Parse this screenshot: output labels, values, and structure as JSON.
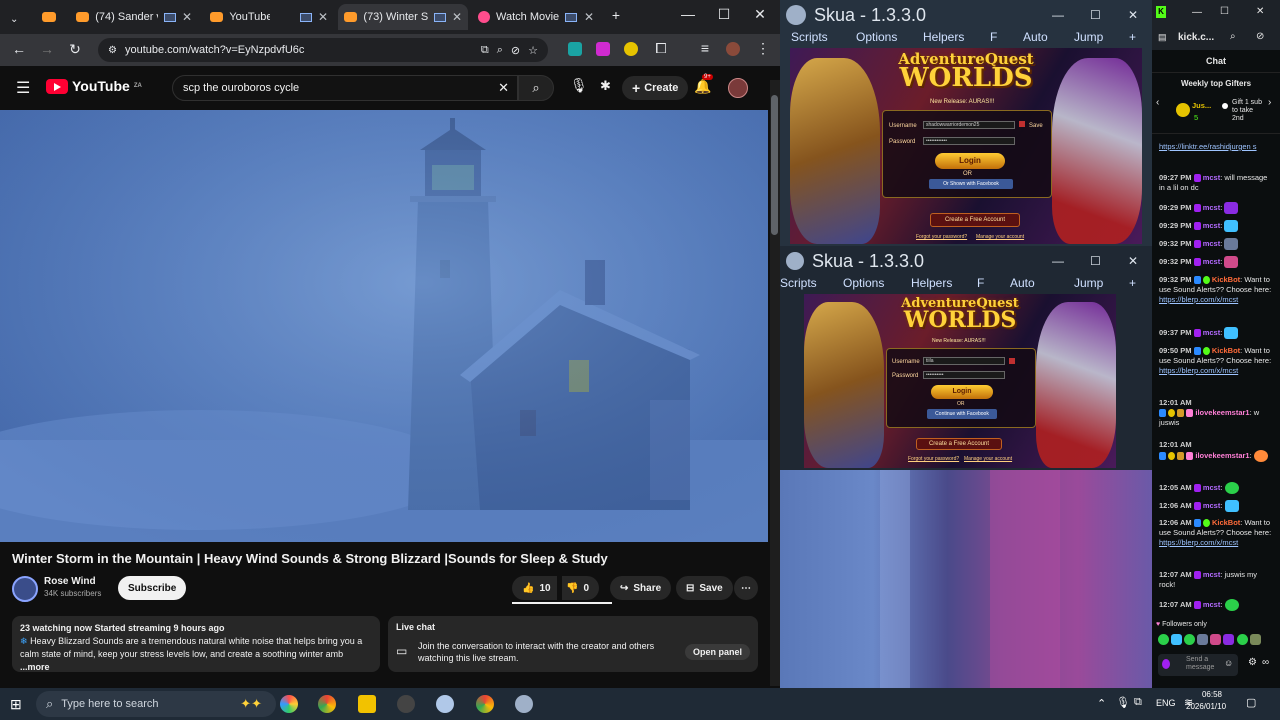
{
  "chrome": {
    "tabs": [
      {
        "label": "(74) Sander v"
      },
      {
        "label": "YouTube"
      },
      {
        "label": "(73) Winter St"
      },
      {
        "label": "Watch Movie"
      }
    ],
    "new_tab": "+",
    "url": "youtube.com/watch?v=EyNzpdvfU6c"
  },
  "youtube": {
    "logo": "YouTube",
    "region": "ZA",
    "search_value": "scp the ouroboros cycle",
    "create_label": "Create",
    "notif_count": "9+",
    "video_title": "Winter Storm in the Mountain | Heavy Wind Sounds & Strong Blizzard |Sounds for Sleep & Study",
    "channel_name": "Rose Wind",
    "subscribers": "34K subscribers",
    "subscribe_label": "Subscribe",
    "likes": "10",
    "dislikes": "0",
    "share_label": "Share",
    "save_label": "Save",
    "desc_stats": "23 watching now  Started streaming 9 hours ago",
    "desc_text": "Heavy Blizzard Sounds are a tremendous natural white noise that helps bring you a calm state of mind, keep your stress levels low, and create a soothing winter amb",
    "desc_more": "...more",
    "live_chat_title": "Live chat",
    "live_chat_text": "Join the conversation to interact with the creator and others watching this live stream.",
    "open_panel": "Open panel"
  },
  "skua_top": {
    "title": "Skua - 1.3.3.0",
    "menu": [
      "Scripts",
      "Options",
      "Helpers",
      "F",
      "Auto",
      "Jump",
      "+"
    ],
    "logo_line1": "AdventureQuest",
    "logo_line2": "WORLDS",
    "release": "New Release: AURAS!!!",
    "username_label": "Username",
    "username_value": "shadowwarriordemon25",
    "password_label": "Password",
    "password_value": "••••••••••••",
    "save_label": "Save",
    "login": "Login",
    "or": "OR",
    "facebook": "Or Shown with Facebook",
    "create": "Create a Free Account",
    "footer_left": "Forgot your password?",
    "footer_right": "Manage your account"
  },
  "skua_bottom": {
    "title": "Skua - 1.3.3.0",
    "menu": [
      "Scripts",
      "Options",
      "Helpers",
      "F",
      "Auto",
      "Jump",
      "+"
    ],
    "logo_line1": "AdventureQuest",
    "logo_line2": "WORLDS",
    "release": "New Release: AURAS!!!",
    "username_label": "Username",
    "username_value": "tiila",
    "password_label": "Password",
    "password_value": "••••••••••",
    "login": "Login",
    "or": "OR",
    "facebook": "Continue with Facebook",
    "create": "Create a Free Account",
    "footer_left": "Forgot your password?",
    "footer_right": "Manage your account"
  },
  "kick": {
    "url": "kick.c...",
    "chat_title": "Chat",
    "gifters_title": "Weekly top Gifters",
    "gifter_name": "Jus...",
    "gifter_count": "5",
    "gift_text": "Gift 1 sub to take 2nd",
    "pinned_link": "https://linktr.ee/rashidjurgen s",
    "messages": [
      {
        "time": "09:27 PM",
        "user": "mcst",
        "text": ": will message in a lil on dc"
      },
      {
        "time": "09:29 PM",
        "user": "mcst",
        "text": ":"
      },
      {
        "time": "09:29 PM",
        "user": "mcst",
        "text": ":"
      },
      {
        "time": "09:32 PM",
        "user": "mcst",
        "text": ":"
      },
      {
        "time": "09:32 PM",
        "user": "mcst",
        "text": ":"
      },
      {
        "time": "09:32 PM",
        "user": "KickBot",
        "text": ": Want to use Sound Alerts?? Choose here:",
        "link": "https://blerp.com/x/mcst"
      },
      {
        "time": "09:37 PM",
        "user": "mcst",
        "text": ":"
      },
      {
        "time": "09:50 PM",
        "user": "KickBot",
        "text": ": Want to use Sound Alerts?? Choose here:",
        "link": "https://blerp.com/x/mcst"
      },
      {
        "time": "12:01 AM",
        "user": "ilovekeemstar1",
        "text": ": w juswis"
      },
      {
        "time": "12:01 AM",
        "user": "ilovekeemstar1",
        "text": ":"
      },
      {
        "time": "12:05 AM",
        "user": "mcst",
        "text": ":"
      },
      {
        "time": "12:06 AM",
        "user": "mcst",
        "text": ":"
      },
      {
        "time": "12:06 AM",
        "user": "KickBot",
        "text": ": Want to use Sound Alerts?? Choose here:",
        "link": "https://blerp.com/x/mcst"
      },
      {
        "time": "12:07 AM",
        "user": "mcst",
        "text": ": juswis my rock!"
      },
      {
        "time": "12:07 AM",
        "user": "mcst",
        "text": ":"
      }
    ],
    "followers_only": "Followers only",
    "send_placeholder": "Send a message"
  },
  "taskbar": {
    "search_placeholder": "Type here to search",
    "lang": "ENG",
    "time": "06:58",
    "date": "2026/01/10"
  }
}
